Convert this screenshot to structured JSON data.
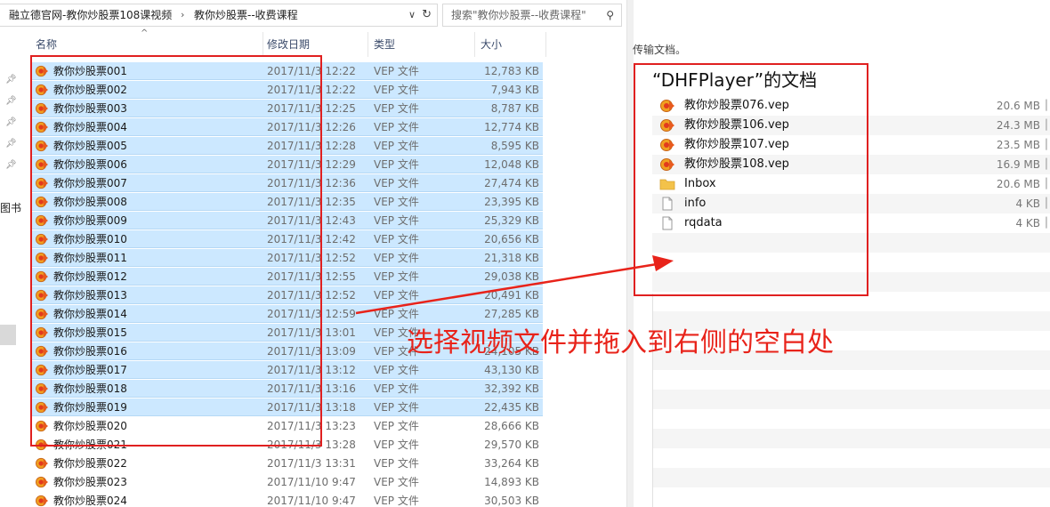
{
  "explorer": {
    "breadcrumb": [
      "融立德官网-教你炒股票108课视频",
      "教你炒股票--收费课程"
    ],
    "search_placeholder": "搜索\"教你炒股票--收费课程\"",
    "columns": {
      "name": "名称",
      "date": "修改日期",
      "type": "类型",
      "size": "大小"
    },
    "nav_label": "图书",
    "files": [
      {
        "name": "教你炒股票001",
        "date": "2017/11/3 12:22",
        "type": "VEP 文件",
        "size": "12,783 KB",
        "selected": true
      },
      {
        "name": "教你炒股票002",
        "date": "2017/11/3 12:22",
        "type": "VEP 文件",
        "size": "7,943 KB",
        "selected": true
      },
      {
        "name": "教你炒股票003",
        "date": "2017/11/3 12:25",
        "type": "VEP 文件",
        "size": "8,787 KB",
        "selected": true
      },
      {
        "name": "教你炒股票004",
        "date": "2017/11/3 12:26",
        "type": "VEP 文件",
        "size": "12,774 KB",
        "selected": true
      },
      {
        "name": "教你炒股票005",
        "date": "2017/11/3 12:28",
        "type": "VEP 文件",
        "size": "8,595 KB",
        "selected": true
      },
      {
        "name": "教你炒股票006",
        "date": "2017/11/3 12:29",
        "type": "VEP 文件",
        "size": "12,048 KB",
        "selected": true
      },
      {
        "name": "教你炒股票007",
        "date": "2017/11/3 12:36",
        "type": "VEP 文件",
        "size": "27,474 KB",
        "selected": true
      },
      {
        "name": "教你炒股票008",
        "date": "2017/11/3 12:35",
        "type": "VEP 文件",
        "size": "23,395 KB",
        "selected": true
      },
      {
        "name": "教你炒股票009",
        "date": "2017/11/3 12:43",
        "type": "VEP 文件",
        "size": "25,329 KB",
        "selected": true
      },
      {
        "name": "教你炒股票010",
        "date": "2017/11/3 12:42",
        "type": "VEP 文件",
        "size": "20,656 KB",
        "selected": true
      },
      {
        "name": "教你炒股票011",
        "date": "2017/11/3 12:52",
        "type": "VEP 文件",
        "size": "21,318 KB",
        "selected": true
      },
      {
        "name": "教你炒股票012",
        "date": "2017/11/3 12:55",
        "type": "VEP 文件",
        "size": "29,038 KB",
        "selected": true
      },
      {
        "name": "教你炒股票013",
        "date": "2017/11/3 12:52",
        "type": "VEP 文件",
        "size": "20,491 KB",
        "selected": true
      },
      {
        "name": "教你炒股票014",
        "date": "2017/11/3 12:59",
        "type": "VEP 文件",
        "size": "27,285 KB",
        "selected": true
      },
      {
        "name": "教你炒股票015",
        "date": "2017/11/3 13:01",
        "type": "VEP 文件",
        "size": "",
        "selected": true
      },
      {
        "name": "教你炒股票016",
        "date": "2017/11/3 13:09",
        "type": "VEP 文件",
        "size": "24,105 KB",
        "selected": true
      },
      {
        "name": "教你炒股票017",
        "date": "2017/11/3 13:12",
        "type": "VEP 文件",
        "size": "43,130 KB",
        "selected": true
      },
      {
        "name": "教你炒股票018",
        "date": "2017/11/3 13:16",
        "type": "VEP 文件",
        "size": "32,392 KB",
        "selected": true
      },
      {
        "name": "教你炒股票019",
        "date": "2017/11/3 13:18",
        "type": "VEP 文件",
        "size": "22,435 KB",
        "selected": true
      },
      {
        "name": "教你炒股票020",
        "date": "2017/11/3 13:23",
        "type": "VEP 文件",
        "size": "28,666 KB",
        "selected": false
      },
      {
        "name": "教你炒股票021",
        "date": "2017/11/3 13:28",
        "type": "VEP 文件",
        "size": "29,570 KB",
        "selected": false
      },
      {
        "name": "教你炒股票022",
        "date": "2017/11/3 13:31",
        "type": "VEP 文件",
        "size": "33,264 KB",
        "selected": false
      },
      {
        "name": "教你炒股票023",
        "date": "2017/11/10 9:47",
        "type": "VEP 文件",
        "size": "14,893 KB",
        "selected": false
      },
      {
        "name": "教你炒股票024",
        "date": "2017/11/10 9:47",
        "type": "VEP 文件",
        "size": "30,503 KB",
        "selected": false
      }
    ]
  },
  "player": {
    "top_text": "传输文档。",
    "title": "“DHFPlayer”的文档",
    "files": [
      {
        "name": "教你炒股票076.vep",
        "size": "20.6 MB",
        "icon": "vep-icon"
      },
      {
        "name": "教你炒股票106.vep",
        "size": "24.3 MB",
        "icon": "vep-icon"
      },
      {
        "name": "教你炒股票107.vep",
        "size": "23.5 MB",
        "icon": "vep-icon"
      },
      {
        "name": "教你炒股票108.vep",
        "size": "16.9 MB",
        "icon": "vep-icon"
      },
      {
        "name": "Inbox",
        "size": "20.6 MB",
        "icon": "folder-icon"
      },
      {
        "name": "info",
        "size": "4 KB",
        "icon": "file-icon"
      },
      {
        "name": "rqdata",
        "size": "4 KB",
        "icon": "file-icon"
      }
    ]
  },
  "annotation": {
    "text": "选择视频文件并拖入到右侧的空白处",
    "color": "#e8231a"
  }
}
